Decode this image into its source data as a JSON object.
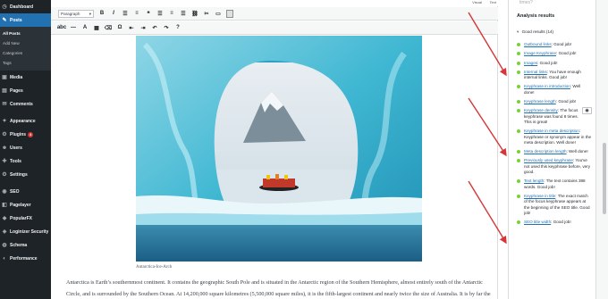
{
  "sidebar": {
    "items": [
      {
        "label": "Dashboard",
        "icon": "dashboard-icon",
        "glyph": "◷"
      },
      {
        "label": "Posts",
        "icon": "pin-icon",
        "glyph": "✎",
        "active": true
      },
      {
        "label": "Media",
        "icon": "media-icon",
        "glyph": "▣"
      },
      {
        "label": "Pages",
        "icon": "pages-icon",
        "glyph": "▤"
      },
      {
        "label": "Comments",
        "icon": "comments-icon",
        "glyph": "✉"
      },
      {
        "label": "Appearance",
        "icon": "brush-icon",
        "glyph": "✦"
      },
      {
        "label": "Plugins",
        "icon": "plugin-icon",
        "glyph": "⚙",
        "badge": "4"
      },
      {
        "label": "Users",
        "icon": "users-icon",
        "glyph": "☻"
      },
      {
        "label": "Tools",
        "icon": "tools-icon",
        "glyph": "✚"
      },
      {
        "label": "Settings",
        "icon": "settings-icon",
        "glyph": "⚙"
      },
      {
        "label": "SEO",
        "icon": "seo-icon",
        "glyph": "◉"
      },
      {
        "label": "Pagelayer",
        "icon": "pagelayer-icon",
        "glyph": "◧"
      },
      {
        "label": "PopularFX",
        "icon": "popularfx-icon",
        "glyph": "◆"
      },
      {
        "label": "Loginizer Security",
        "icon": "shield-icon",
        "glyph": "◈"
      },
      {
        "label": "Schema",
        "icon": "schema-icon",
        "glyph": "◍"
      },
      {
        "label": "Performance",
        "icon": "performance-icon",
        "glyph": "◐"
      }
    ],
    "posts_submenu": [
      "All Posts",
      "Add New",
      "Categories",
      "Tags"
    ]
  },
  "editor": {
    "format_select": "Paragraph",
    "visual_tab": "Visual",
    "text_tab": "Text",
    "caption": "Antarctica-Ice-Arch",
    "paragraph_line1": "Antarctica is Earth’s southernmost continent. It contains the geographic South Pole and is situated in the Antarctic region of the Southern Hemisphere, almost entirely south of the Antarctic",
    "paragraph_line2": "Circle, and is surrounded by the Southern Ocean. At 14,200,000 square kilometres (5,500,000 square miles), it is the fifth-largest continent and nearly twice the size of Australia. It is by far the"
  },
  "panel": {
    "top_text": "times?",
    "title": "Analysis results",
    "good_results": "Good results (14)",
    "results": [
      {
        "link": "Outbound links",
        "text": ": Good job!"
      },
      {
        "link": "Image Keyphrase",
        "text": ": Good job!"
      },
      {
        "link": "Images",
        "text": ": Good job!"
      },
      {
        "link": "Internal links",
        "text": ": You have enough internal links. Good job!"
      },
      {
        "link": "Keyphrase in introduction",
        "text": ": Well done!"
      },
      {
        "link": "Keyphrase length",
        "text": ": Good job!"
      },
      {
        "link": "Keyphrase density",
        "text": ": The focus keyphrase was found 8 times. This is great!",
        "eye": true
      },
      {
        "link": "Keyphrase in meta description",
        "text": ": Keyphrase or synonym appear in the meta description. Well done!"
      },
      {
        "link": "Meta description length",
        "text": ": Well done!"
      },
      {
        "link": "Previously used keyphrase",
        "text": ": You've not used this keyphrase before, very good."
      },
      {
        "link": "Text length",
        "text": ": The text contains 388 words. Good job!"
      },
      {
        "link": "Keyphrase in title",
        "text": ": The exact match of the focus keyphrase appears at the beginning of the SEO title. Good job!"
      },
      {
        "link": "SEO title width",
        "text": ": Good job!"
      }
    ]
  },
  "colors": {
    "sidebar_bg": "#1d2327",
    "active": "#2271b1",
    "good_bullet": "#7ad03a",
    "arrow": "#d63638"
  }
}
